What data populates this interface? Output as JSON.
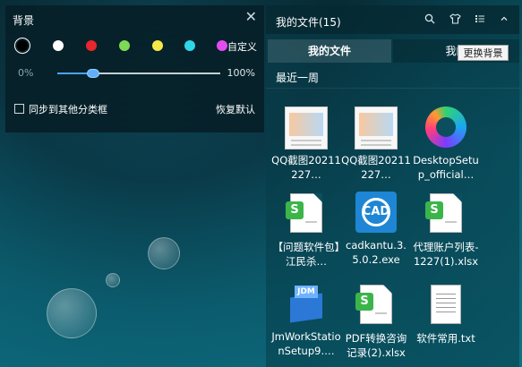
{
  "background_panel": {
    "title": "背景",
    "close_icon": "close-icon",
    "colors": [
      "#000000",
      "#ffffff",
      "#e8262e",
      "#7ed957",
      "#f7e84a",
      "#2fd6e8",
      "#e44cf0"
    ],
    "selected_color_index": 0,
    "custom_label": "自定义",
    "opacity_min": "0%",
    "opacity_max": "100%",
    "opacity_value_fraction": 0.22,
    "sync_label": "同步到其他分类框",
    "restore_label": "恢复默认"
  },
  "files_panel": {
    "title": "我的文件(15)",
    "header_icons": [
      "search-icon",
      "shirt-icon",
      "list-icon",
      "collapse-icon"
    ],
    "tabs": [
      {
        "label": "我的文件"
      },
      {
        "label": "我的"
      }
    ],
    "tooltip": "更换背景",
    "section": "最近一周",
    "files": [
      {
        "name": "QQ截图20211227…",
        "type": "image"
      },
      {
        "name": "QQ截图20211227…",
        "type": "image"
      },
      {
        "name": "DesktopSetup_official…",
        "type": "edge"
      },
      {
        "name": "【问题软件包】江民杀…",
        "type": "xlsx"
      },
      {
        "name": "cadkantu.3.5.0.2.exe",
        "type": "cad"
      },
      {
        "name": "代理账户列表-1227(1).xlsx",
        "type": "xlsx"
      },
      {
        "name": "JmWorkStationSetup9.…",
        "type": "jm"
      },
      {
        "name": "PDF转换咨询记录(2).xlsx",
        "type": "xlsx"
      },
      {
        "name": "软件常用.txt",
        "type": "txt"
      }
    ]
  }
}
